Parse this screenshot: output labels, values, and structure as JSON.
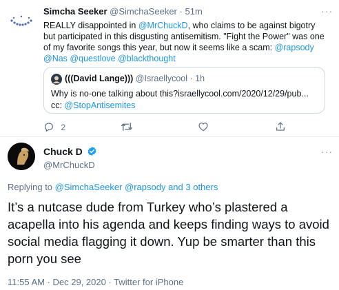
{
  "tweet1": {
    "name": "Simcha Seeker",
    "handle": "@SimchaSeeker",
    "time": "51m",
    "text_before": "REALLY disappointed in ",
    "mention1": "@MrChuckD",
    "text_middle": ", who claims to be against bigotry but participated in this disgusting antisemitism. \"Fight the Power\" was one of my favorite songs this year, but now it seems like a scam: ",
    "mention2": "@rapsody",
    "mention3": "@Nas",
    "mention4": "@questlove",
    "mention5": "@blackthought",
    "quote": {
      "name": "(((David Lange)))",
      "handle": "@Israellycool",
      "time": "1h",
      "text": "Why is no-one talking about this?israellycool.com/2020/12/29/pub... cc: ",
      "mention": "@StopAntisemites"
    },
    "actions": {
      "reply_count": "2",
      "retweet_count": "",
      "like_count": ""
    }
  },
  "tweet2": {
    "name": "Chuck D",
    "handle": "@MrChuckD",
    "replying_prefix": "Replying to ",
    "replying_to": "@SimchaSeeker @rapsody",
    "replying_suffix": " and 3 others",
    "text": "It’s a nutcase dude from Turkey who’s plastered a acapella into his agenda and keeps finding ways to avoid social media flagging it down. Yup be smarter than this porn you see",
    "meta": "11:55 AM · Dec 29, 2020 · Twitter for iPhone"
  },
  "icons": {
    "more": "···",
    "verified": "verified-badge-icon"
  },
  "colors": {
    "link": "#1b95e0",
    "muted": "#5b7083",
    "verified": "#1da1f2"
  }
}
